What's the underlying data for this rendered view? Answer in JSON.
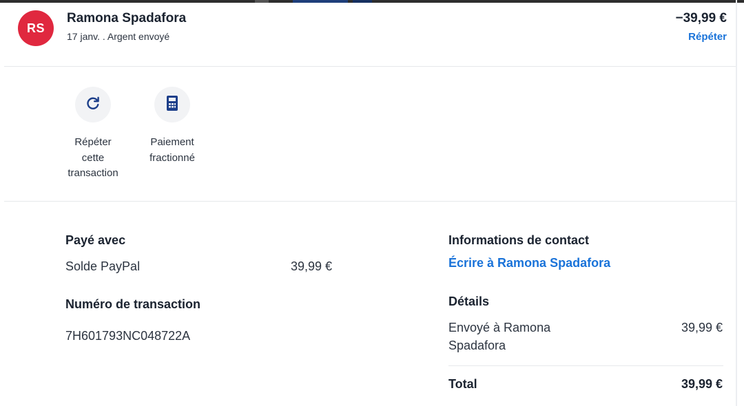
{
  "header": {
    "avatar_initials": "RS",
    "name": "Ramona Spadafora",
    "subline": "17 janv. . Argent envoyé",
    "amount": "−39,99 €",
    "repeat_link": "Répéter"
  },
  "actions": [
    {
      "icon": "refresh-icon",
      "label_lines": [
        "Répéter",
        "cette",
        "transaction"
      ]
    },
    {
      "icon": "calculator-icon",
      "label_lines": [
        "Paiement",
        "fractionné"
      ]
    }
  ],
  "payment": {
    "title": "Payé avec",
    "method": "Solde PayPal",
    "amount": "39,99 €"
  },
  "transaction": {
    "title": "Numéro de transaction",
    "id": "7H601793NC048722A"
  },
  "contact": {
    "title": "Informations de contact",
    "link": "Écrire à Ramona Spadafora"
  },
  "details": {
    "title": "Détails",
    "sent_to_line1": "Envoyé à Ramona",
    "sent_to_line2": "Spadafora",
    "sent_amount": "39,99 €",
    "total_label": "Total",
    "total_amount": "39,99 €"
  },
  "colors": {
    "accent": "#1a73d9",
    "avatar": "#e0283f",
    "text": "#1b2330"
  }
}
